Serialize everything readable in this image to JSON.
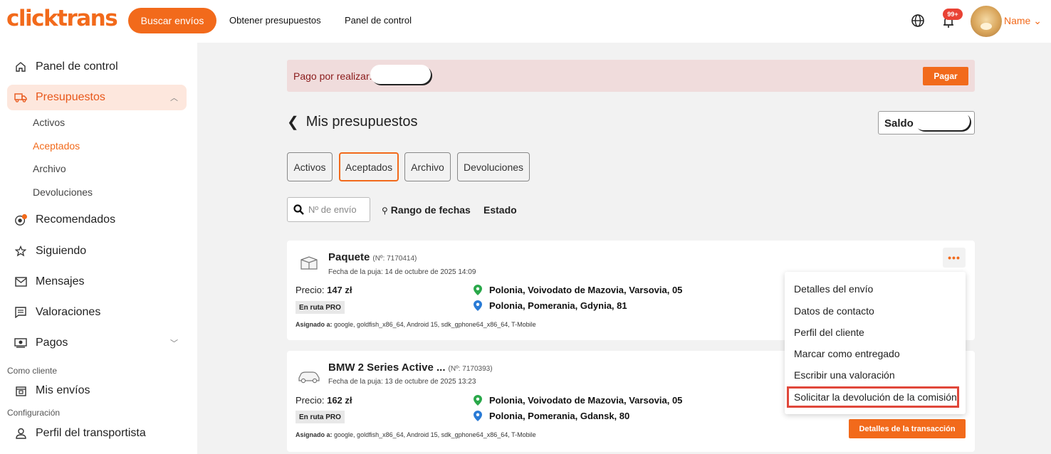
{
  "header": {
    "logo": "clicktrans",
    "search_button": "Buscar envíos",
    "nav": [
      "Obtener presupuestos",
      "Panel de control"
    ],
    "notification_badge": "99+",
    "user_name": "Name"
  },
  "sidebar": {
    "items": [
      {
        "label": "Panel de control",
        "icon": "home-icon"
      },
      {
        "label": "Presupuestos",
        "icon": "truck-icon"
      },
      {
        "label": "Recomendados",
        "icon": "target-icon"
      },
      {
        "label": "Siguiendo",
        "icon": "star-icon"
      },
      {
        "label": "Mensajes",
        "icon": "mail-icon"
      },
      {
        "label": "Valoraciones",
        "icon": "comment-icon"
      },
      {
        "label": "Pagos",
        "icon": "cash-icon"
      }
    ],
    "sub_items": [
      "Activos",
      "Aceptados",
      "Archivo",
      "Devoluciones"
    ],
    "section_client": "Como cliente",
    "client_items": [
      {
        "label": "Mis envíos",
        "icon": "calendar-icon"
      }
    ],
    "section_config": "Configuración",
    "config_items": [
      {
        "label": "Perfil del transportista",
        "icon": "user-icon"
      }
    ]
  },
  "main": {
    "pay_label": "Pago por realizar:",
    "pay_button": "Pagar",
    "title": "Mis presupuestos",
    "saldo_label": "Saldo",
    "tabs": [
      "Activos",
      "Aceptados",
      "Archivo",
      "Devoluciones"
    ],
    "active_tab": "Aceptados",
    "search_placeholder": "Nº de envío",
    "filter_date": "Rango de fechas",
    "filter_status": "Estado",
    "cards": [
      {
        "title": "Paquete",
        "number": "(Nº: 7170414)",
        "date": "Fecha de la puja: 14 de octubre de 2025 14:09",
        "price_label": "Precio:",
        "price": "147 zł",
        "badge": "En ruta PRO",
        "assign_label": "Asignado a:",
        "assign": "google, goldfish_x86_64, Android 15, sdk_gphone64_x86_64, T-Mobile",
        "from": "Polonia, Voivodato de Mazovia, Varsovia, 05",
        "to": "Polonia, Pomerania, Gdynia, 81"
      },
      {
        "title": "BMW 2 Series Active ...",
        "number": "(Nº: 7170393)",
        "date": "Fecha de la puja: 13 de octubre de 2025 13:23",
        "price_label": "Precio:",
        "price": "162 zł",
        "badge": "En ruta PRO",
        "assign_label": "Asignado a:",
        "assign": "google, goldfish_x86_64, Android 15, sdk_gphone64_x86_64, T-Mobile",
        "from": "Polonia, Voivodato de Mazovia, Varsovia, 05",
        "to": "Polonia, Pomerania, Gdansk, 80",
        "detail_button": "Detalles de la transacción"
      }
    ],
    "more_icon": "•••"
  },
  "menu": {
    "items": [
      "Detalles del envío",
      "Datos de contacto",
      "Perfil del cliente",
      "Marcar como entregado",
      "Escribir una valoración",
      "Solicitar la devolución de la comisión"
    ]
  },
  "colors": {
    "accent": "#f26a1b",
    "highlight": "#e0473a"
  }
}
